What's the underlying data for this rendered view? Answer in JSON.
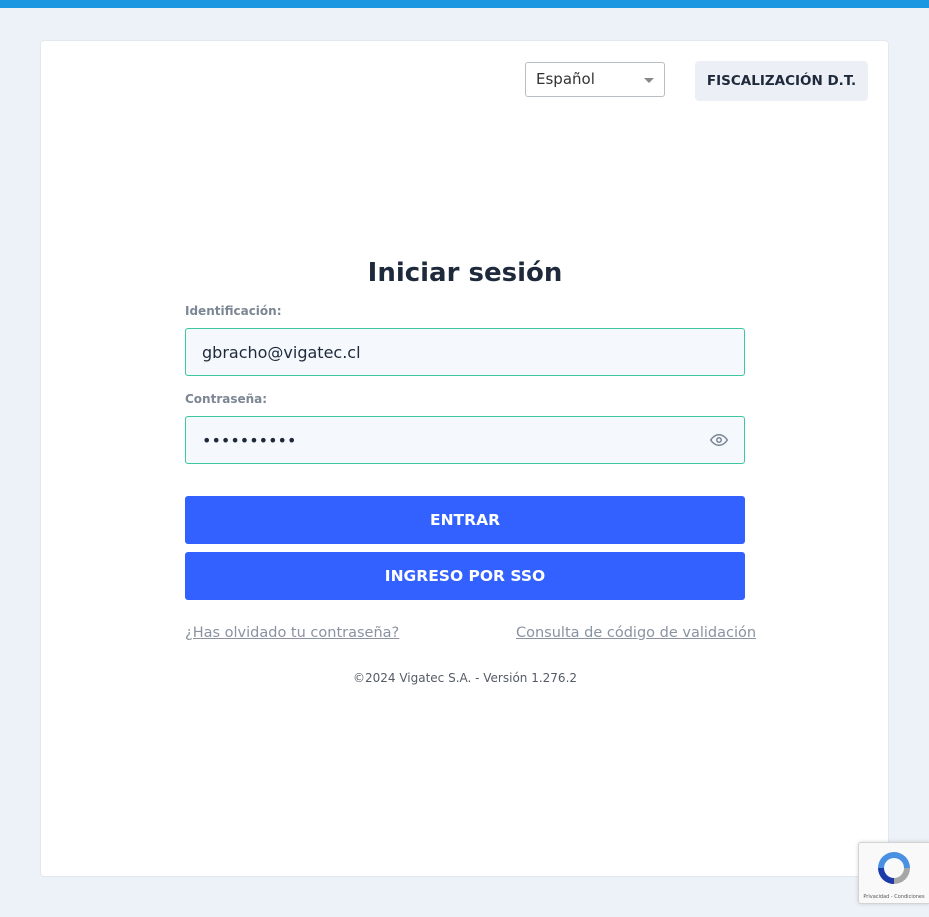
{
  "colors": {
    "top_bar": "#1a97e0",
    "primary_button": "#3361ff",
    "field_border": "#3cc89a",
    "background": "#edf1f8"
  },
  "header": {
    "language_select": {
      "selected": "Español"
    },
    "fiscalizacion_button": "FISCALIZACIÓN D.T."
  },
  "login": {
    "title": "Iniciar sesión",
    "id_label": "Identificación:",
    "id_value": "gbracho@vigatec.cl",
    "password_label": "Contraseña:",
    "password_masked": "••••••••••",
    "password_toggle_icon": "eye-icon",
    "submit_button": "ENTRAR",
    "sso_button": "INGRESO POR SSO",
    "forgot_password_link": "¿Has olvidado tu contraseña?",
    "validation_code_link": "Consulta de código de validación"
  },
  "footer": {
    "text": "©2024 Vigatec S.A. - Versión 1.276.2"
  },
  "recaptcha": {
    "icon": "recaptcha-icon",
    "text": "Privacidad - Condiciones"
  }
}
